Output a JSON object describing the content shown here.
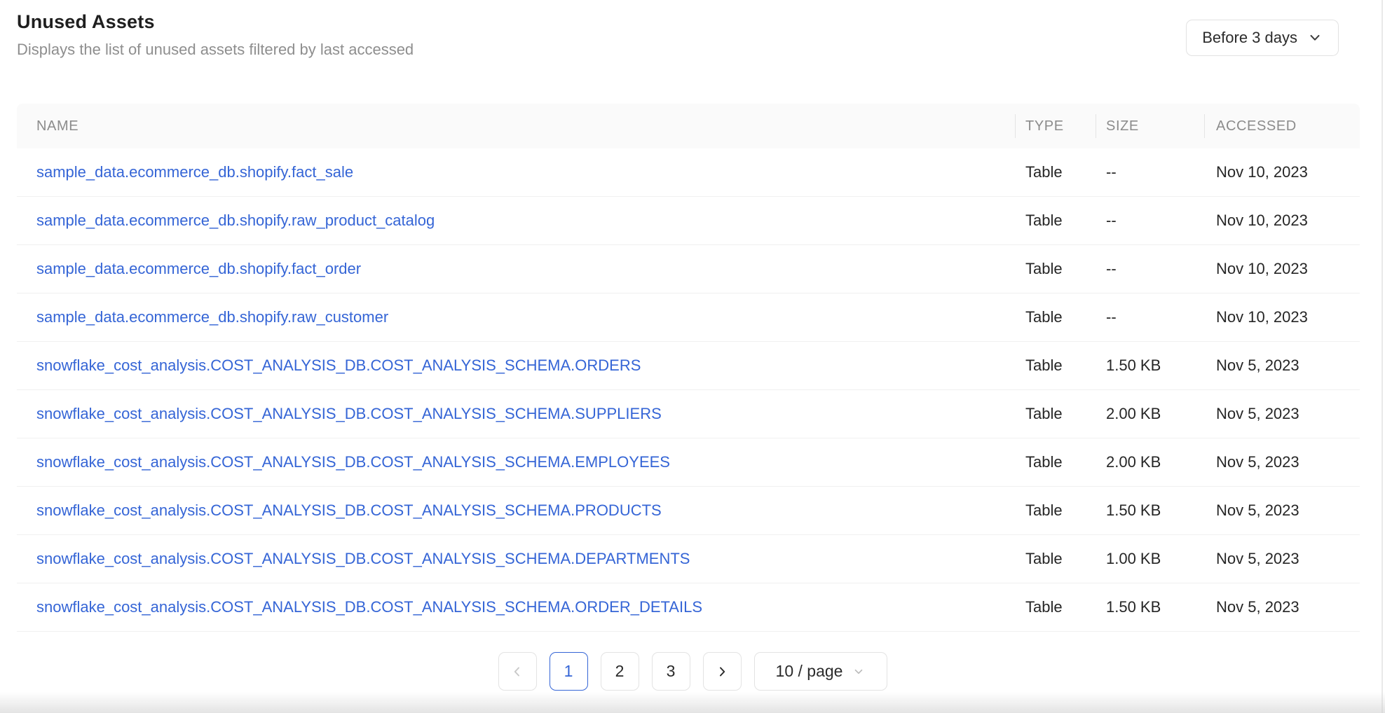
{
  "colors": {
    "accent": "#3565d6"
  },
  "page": {
    "title": "Unused Assets",
    "subtitle": "Displays the list of unused assets filtered by last accessed"
  },
  "filter": {
    "selected": "Before 3 days"
  },
  "table": {
    "columns": {
      "name": "NAME",
      "type": "TYPE",
      "size": "SIZE",
      "accessed": "ACCESSED"
    },
    "rows": [
      {
        "name": "sample_data.ecommerce_db.shopify.fact_sale",
        "type": "Table",
        "size": "--",
        "accessed": "Nov 10, 2023"
      },
      {
        "name": "sample_data.ecommerce_db.shopify.raw_product_catalog",
        "type": "Table",
        "size": "--",
        "accessed": "Nov 10, 2023"
      },
      {
        "name": "sample_data.ecommerce_db.shopify.fact_order",
        "type": "Table",
        "size": "--",
        "accessed": "Nov 10, 2023"
      },
      {
        "name": "sample_data.ecommerce_db.shopify.raw_customer",
        "type": "Table",
        "size": "--",
        "accessed": "Nov 10, 2023"
      },
      {
        "name": "snowflake_cost_analysis.COST_ANALYSIS_DB.COST_ANALYSIS_SCHEMA.ORDERS",
        "type": "Table",
        "size": "1.50 KB",
        "accessed": "Nov 5, 2023"
      },
      {
        "name": "snowflake_cost_analysis.COST_ANALYSIS_DB.COST_ANALYSIS_SCHEMA.SUPPLIERS",
        "type": "Table",
        "size": "2.00 KB",
        "accessed": "Nov 5, 2023"
      },
      {
        "name": "snowflake_cost_analysis.COST_ANALYSIS_DB.COST_ANALYSIS_SCHEMA.EMPLOYEES",
        "type": "Table",
        "size": "2.00 KB",
        "accessed": "Nov 5, 2023"
      },
      {
        "name": "snowflake_cost_analysis.COST_ANALYSIS_DB.COST_ANALYSIS_SCHEMA.PRODUCTS",
        "type": "Table",
        "size": "1.50 KB",
        "accessed": "Nov 5, 2023"
      },
      {
        "name": "snowflake_cost_analysis.COST_ANALYSIS_DB.COST_ANALYSIS_SCHEMA.DEPARTMENTS",
        "type": "Table",
        "size": "1.00 KB",
        "accessed": "Nov 5, 2023"
      },
      {
        "name": "snowflake_cost_analysis.COST_ANALYSIS_DB.COST_ANALYSIS_SCHEMA.ORDER_DETAILS",
        "type": "Table",
        "size": "1.50 KB",
        "accessed": "Nov 5, 2023"
      }
    ]
  },
  "pagination": {
    "pages": [
      "1",
      "2",
      "3"
    ],
    "active_page": "1",
    "prev_disabled": true,
    "page_size": "10 / page"
  }
}
